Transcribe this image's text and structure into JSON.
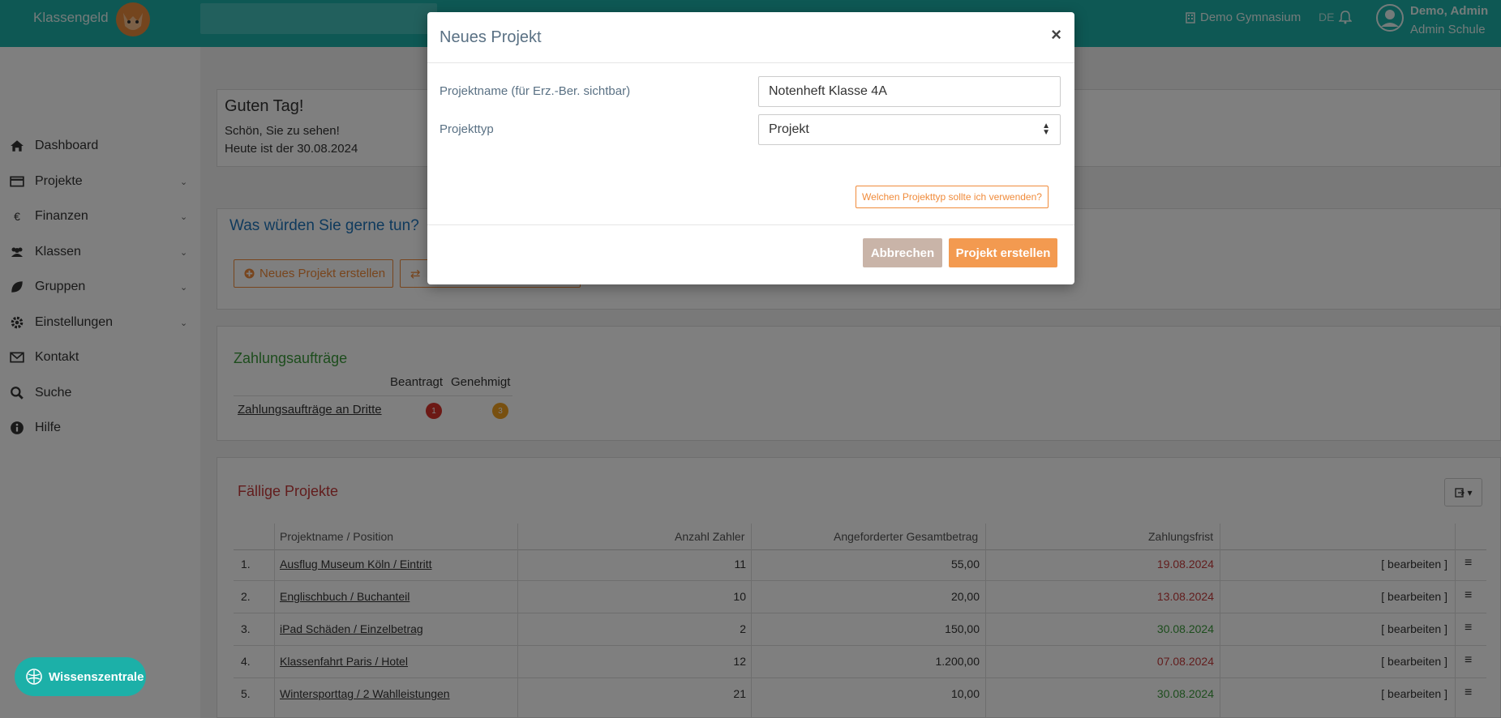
{
  "header": {
    "brand": "Klassengeld",
    "school": "Demo Gymnasium",
    "lang": "DE",
    "user_name": "Demo, Admin",
    "user_role": "Admin Schule"
  },
  "sidebar": {
    "items": [
      {
        "label": "Dashboard",
        "icon": "home-icon",
        "chevron": false
      },
      {
        "label": "Projekte",
        "icon": "card-icon",
        "chevron": true
      },
      {
        "label": "Finanzen",
        "icon": "euro-icon",
        "chevron": true
      },
      {
        "label": "Klassen",
        "icon": "users-icon",
        "chevron": true
      },
      {
        "label": "Gruppen",
        "icon": "leaf-icon",
        "chevron": true
      },
      {
        "label": "Einstellungen",
        "icon": "gear-icon",
        "chevron": true
      },
      {
        "label": "Kontakt",
        "icon": "envelope-icon",
        "chevron": false
      },
      {
        "label": "Suche",
        "icon": "search-icon",
        "chevron": false
      },
      {
        "label": "Hilfe",
        "icon": "info-icon",
        "chevron": false
      }
    ]
  },
  "greeting": {
    "title": "Guten Tag!",
    "line1": "Schön, Sie zu sehen!",
    "line2": "Heute ist der 30.08.2024"
  },
  "actions": {
    "title": "Was würden Sie gerne tun?",
    "new_project": "Neues Projekt erstellen"
  },
  "zahlungen": {
    "title": "Zahlungsaufträge",
    "col_beantragt": "Beantragt",
    "col_genehmigt": "Genehmigt",
    "row_label": "Zahlungsaufträge an Dritte",
    "beantragt": "1",
    "genehmigt": "3"
  },
  "faellig": {
    "title": "Fällige Projekte",
    "headers": {
      "name": "Projektname / Position",
      "zahler": "Anzahl Zahler",
      "betrag": "Angeforderter Gesamtbetrag",
      "frist": "Zahlungsfrist"
    },
    "edit_label": "[ bearbeiten ]",
    "rows": [
      {
        "nr": "1.",
        "name": "Ausflug Museum Köln / Eintritt",
        "zahler": "11",
        "betrag": "55,00",
        "frist": "19.08.2024",
        "status": "red"
      },
      {
        "nr": "2.",
        "name": "Englischbuch / Buchanteil",
        "zahler": "10",
        "betrag": "20,00",
        "frist": "13.08.2024",
        "status": "red"
      },
      {
        "nr": "3.",
        "name": "iPad Schäden / Einzelbetrag",
        "zahler": "2",
        "betrag": "150,00",
        "frist": "30.08.2024",
        "status": "green"
      },
      {
        "nr": "4.",
        "name": "Klassenfahrt Paris / Hotel",
        "zahler": "12",
        "betrag": "1.200,00",
        "frist": "07.08.2024",
        "status": "red"
      },
      {
        "nr": "5.",
        "name": "Wintersporttag / 2 Wahlleistungen",
        "zahler": "21",
        "betrag": "10,00",
        "frist": "30.08.2024",
        "status": "green"
      }
    ]
  },
  "modal": {
    "title": "Neues Projekt",
    "close": "×",
    "name_label": "Projektname (für Erz.-Ber. sichtbar)",
    "name_value": "Notenheft Klasse 4A",
    "type_label": "Projekttyp",
    "type_value": "Projekt",
    "help": "Welchen Projekttyp sollte ich verwenden?",
    "cancel": "Abbrechen",
    "create": "Projekt erstellen"
  },
  "wissen": {
    "label": "Wissenszentrale"
  },
  "colors": {
    "teal": "#1cb0a8",
    "orange": "#f08b3b",
    "red": "#c43a3a",
    "green": "#3a9a3a",
    "blue": "#1e74bb"
  }
}
